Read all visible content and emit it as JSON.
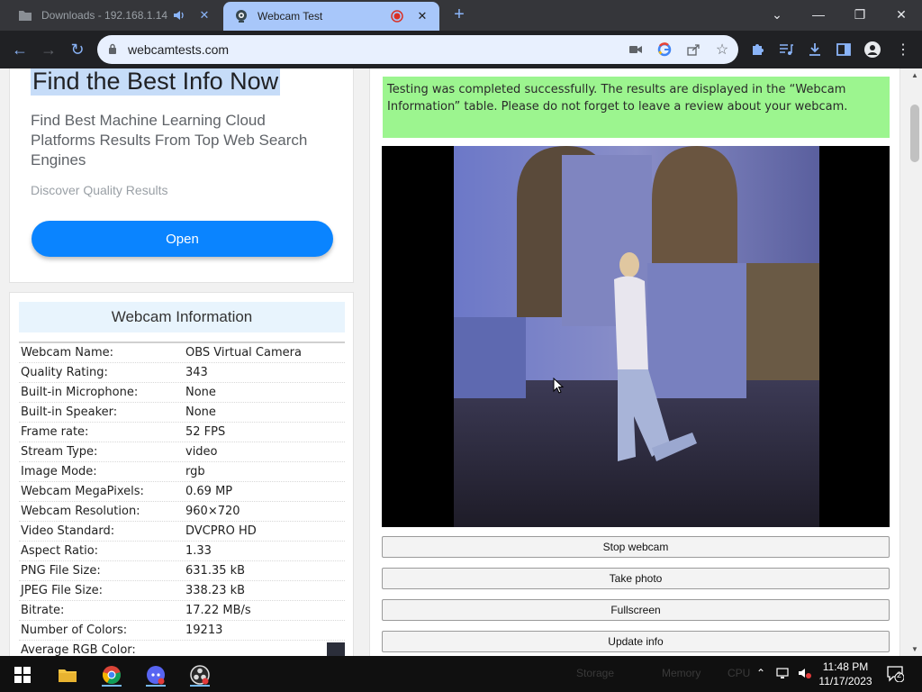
{
  "browser": {
    "tabs": [
      {
        "title": "Downloads - 192.168.1.14",
        "active": false
      },
      {
        "title": "Webcam Test",
        "active": true
      }
    ],
    "new_tab": "+",
    "url": "webcamtests.com"
  },
  "ad": {
    "headline": "Find the Best Info Now",
    "description": "Find Best Machine Learning Cloud Platforms Results From Top Web Search Engines",
    "subtext": "Discover Quality Results",
    "button": "Open"
  },
  "info": {
    "title": "Webcam Information",
    "rows": [
      {
        "label": "Webcam Name:",
        "value": "OBS Virtual Camera"
      },
      {
        "label": "Quality Rating:",
        "value": "343"
      },
      {
        "label": "Built-in Microphone:",
        "value": "None"
      },
      {
        "label": "Built-in Speaker:",
        "value": "None"
      },
      {
        "label": "Frame rate:",
        "value": "52 FPS"
      },
      {
        "label": "Stream Type:",
        "value": "video"
      },
      {
        "label": "Image Mode:",
        "value": "rgb"
      },
      {
        "label": "Webcam MegaPixels:",
        "value": "0.69 MP"
      },
      {
        "label": "Webcam Resolution:",
        "value": "960×720"
      },
      {
        "label": "Video Standard:",
        "value": "DVCPRO HD"
      },
      {
        "label": "Aspect Ratio:",
        "value": "1.33"
      },
      {
        "label": "PNG File Size:",
        "value": "631.35 kB"
      },
      {
        "label": "JPEG File Size:",
        "value": "338.23 kB"
      },
      {
        "label": "Bitrate:",
        "value": "17.22 MB/s"
      },
      {
        "label": "Number of Colors:",
        "value": "19213"
      },
      {
        "label": "Average RGB Color:",
        "value": ""
      }
    ],
    "average_color": "#2b2e3a"
  },
  "test": {
    "success_message": "Testing was completed successfully. The results are displayed in the “Webcam Information” table. Please do not forget to leave a review about your webcam.",
    "buttons": {
      "stop": "Stop webcam",
      "photo": "Take photo",
      "fullscreen": "Fullscreen",
      "update": "Update info"
    }
  },
  "taskbar": {
    "time": "11:48 PM",
    "date": "11/17/2023",
    "notification_count": "2",
    "faded_labels": [
      "Storage",
      "Memory",
      "CPU"
    ]
  },
  "colors": {
    "accent": "#0a84ff",
    "success_bg": "#9cf58f",
    "info_title_bg": "#e8f4fd",
    "active_tab": "#a8c7fa"
  }
}
